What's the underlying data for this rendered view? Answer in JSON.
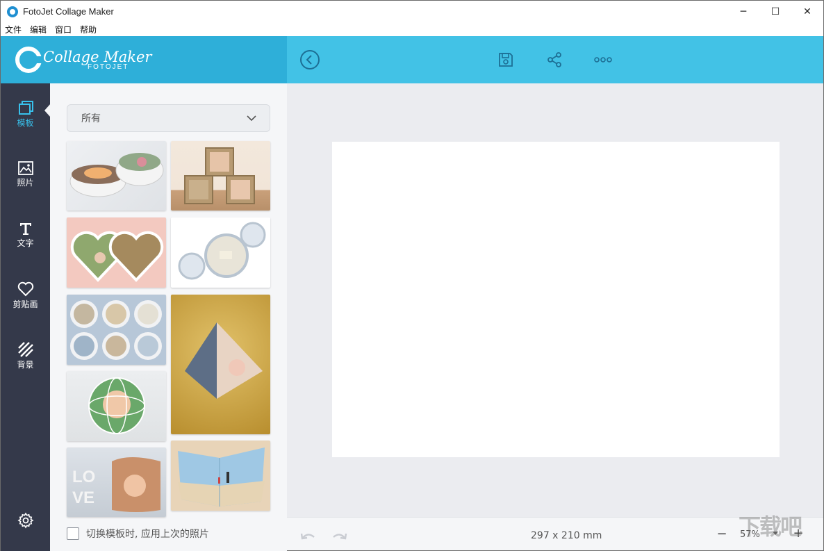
{
  "window": {
    "title": "FotoJet Collage Maker",
    "controls": {
      "minimize": "─",
      "maximize": "☐",
      "close": "✕"
    }
  },
  "menu": [
    "文件",
    "编辑",
    "窗口",
    "帮助"
  ],
  "brand": {
    "main": "Collage Maker",
    "sub": "FOTOJET",
    "color": "#2eafd9",
    "toolbar_color": "#42c2e6"
  },
  "toolbar": {
    "icons": [
      "back-icon",
      "save-icon",
      "share-icon",
      "more-icon"
    ]
  },
  "nav": [
    {
      "label": "模板",
      "icon": "template-icon",
      "active": true
    },
    {
      "label": "照片",
      "icon": "photo-icon"
    },
    {
      "label": "文字",
      "icon": "text-icon"
    },
    {
      "label": "剪贴画",
      "icon": "clipart-icon"
    },
    {
      "label": "背景",
      "icon": "background-icon"
    }
  ],
  "settings_icon": "gear-icon",
  "templates": {
    "filter": "所有",
    "items": [
      "bowls-collage",
      "baby-blocks-collage",
      "hearts-collage",
      "bubbles-collage",
      "beach-circles-collage",
      "pyramid-collage",
      "globe-collage",
      "love-cube-collage",
      "folded-beach-collage"
    ],
    "reuse_photos_label": "切换模板时, 应用上次的照片"
  },
  "canvas": {
    "page_size": "297 x 210 mm",
    "zoom": "57%",
    "zoom_minus": "−",
    "zoom_plus": "+"
  },
  "watermark": "下载吧"
}
